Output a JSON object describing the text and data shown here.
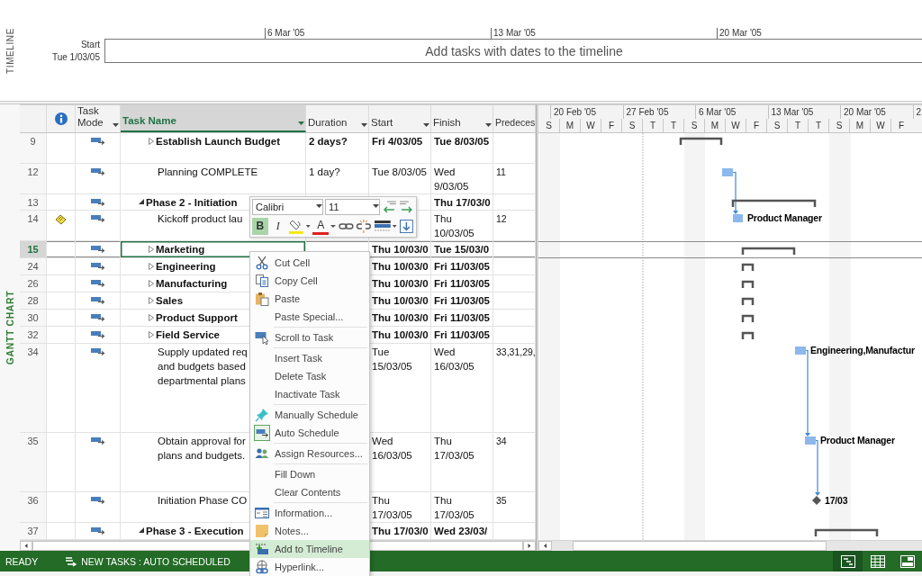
{
  "timeline": {
    "label": "TIMELINE",
    "ticks": [
      "6 Mar '05",
      "13 Mar '05",
      "20 Mar '05"
    ],
    "start_label": "Start",
    "start_date": "Tue 1/03/05",
    "placeholder": "Add tasks with dates to the timeline"
  },
  "view_label": "GANTT CHART",
  "table": {
    "columns": [
      {
        "kind": "row-number",
        "selected": false
      },
      {
        "kind": "indicators",
        "selected": false
      },
      {
        "kind": "heading",
        "label": "Task Mode",
        "filter": true,
        "selected": false
      },
      {
        "kind": "heading",
        "label": "Task Name",
        "filter": true,
        "selected": true
      },
      {
        "kind": "heading",
        "label": "Duration",
        "filter": true,
        "selected": false
      },
      {
        "kind": "heading",
        "label": "Start",
        "filter": true,
        "selected": false
      },
      {
        "kind": "heading",
        "label": "Finish",
        "filter": true,
        "selected": false
      },
      {
        "kind": "heading",
        "label": "Predeces",
        "filter": false,
        "selected": false
      }
    ],
    "leading_rows": [
      {
        "id": "9",
        "kind": "summary",
        "expanded": false,
        "note": false,
        "selected": false,
        "name": "Establish Launch Budget",
        "duration": "2 days?",
        "start": "Fri 4/03/05",
        "finish": "Tue 8/03/05",
        "bar": {
          "kind": "summary"
        }
      },
      {
        "id": "12",
        "kind": "task",
        "note": false,
        "selected": false,
        "name": "Planning COMPLETE",
        "duration": "1 day?",
        "start": "Tue 8/03/05",
        "finish": "Wed\n9/03/05",
        "predecessors": "11",
        "bar": {
          "kind": "task"
        }
      }
    ],
    "rows": [
      {
        "id": "13",
        "kind": "summary",
        "expanded": true,
        "note": false,
        "selected": false,
        "name": "Phase 2 - Initiation",
        "finish": "Thu 17/03/0",
        "bar": {
          "kind": "summary"
        },
        "children": [
          {
            "id": "14",
            "kind": "task",
            "note": true,
            "selected": false,
            "name": "Kickoff product lau",
            "finish": "Thu\n10/03/05",
            "predecessors": "12",
            "bar": {
              "kind": "task",
              "label": "Product Manager"
            }
          },
          {
            "id": "15",
            "kind": "summary",
            "expanded": false,
            "note": false,
            "selected": true,
            "name": "Marketing",
            "start": "Thu 10/03/0",
            "finish": "Tue 15/03/0",
            "bar": {
              "kind": "summary"
            }
          },
          {
            "id": "24",
            "kind": "summary",
            "expanded": false,
            "note": false,
            "selected": false,
            "name": "Engineering",
            "start": "Thu 10/03/0",
            "finish": "Fri 11/03/05",
            "bar": {
              "kind": "summary"
            }
          },
          {
            "id": "26",
            "kind": "summary",
            "expanded": false,
            "note": false,
            "selected": false,
            "name": "Manufacturing",
            "start": "Thu 10/03/0",
            "finish": "Fri 11/03/05",
            "bar": {
              "kind": "summary"
            }
          },
          {
            "id": "28",
            "kind": "summary",
            "expanded": false,
            "note": false,
            "selected": false,
            "name": "Sales",
            "start": "Thu 10/03/0",
            "finish": "Fri 11/03/05",
            "bar": {
              "kind": "summary"
            }
          },
          {
            "id": "30",
            "kind": "summary",
            "expanded": false,
            "note": false,
            "selected": false,
            "name": "Product Support",
            "start": "Thu 10/03/0",
            "finish": "Fri 11/03/05",
            "bar": {
              "kind": "summary"
            }
          },
          {
            "id": "32",
            "kind": "summary",
            "expanded": false,
            "note": false,
            "selected": false,
            "name": "Field Service",
            "start": "Thu 10/03/0",
            "finish": "Fri 11/03/05",
            "bar": {
              "kind": "summary"
            }
          },
          {
            "id": "34",
            "kind": "task",
            "note": false,
            "selected": false,
            "name": "Supply updated req\nand budgets based\ndepartmental plans",
            "start": "Tue\n15/03/05",
            "finish": "Wed\n16/03/05",
            "predecessors": "33,31,29,",
            "bar": {
              "kind": "task",
              "label": "Engineering,Manufactur"
            }
          },
          {
            "id": "35",
            "kind": "task",
            "note": false,
            "selected": false,
            "name": "Obtain approval for\nplans and budgets.",
            "start": "Wed\n16/03/05",
            "finish": "Thu\n17/03/05",
            "predecessors": "34",
            "bar": {
              "kind": "task",
              "label": "Product Manager"
            }
          },
          {
            "id": "36",
            "kind": "task",
            "note": false,
            "selected": false,
            "name": "Initiation Phase CO",
            "start": "Thu\n17/03/05",
            "finish": "Thu\n17/03/05",
            "predecessors": "35",
            "bar": {
              "kind": "milestone",
              "label": "17/03"
            }
          }
        ]
      },
      {
        "id": "37",
        "kind": "summary",
        "expanded": true,
        "note": false,
        "selected": false,
        "name": "Phase 3 - Execution",
        "start": "Thu 17/03/0",
        "finish": "Wed 23/03/",
        "bar": {
          "kind": "summary"
        }
      }
    ]
  },
  "gantt": {
    "weeks": [
      "20 Feb '05",
      "27 Feb '05",
      "6 Mar '05",
      "13 Mar '05",
      "20 Mar '05",
      "2"
    ],
    "days": [
      "S",
      "M",
      "W",
      "F",
      "S",
      "T",
      "T",
      "S",
      "M",
      "W",
      "F",
      "S",
      "T",
      "T",
      "S",
      "M",
      "W",
      "F"
    ]
  },
  "mini_toolbar": {
    "font": "Calibri",
    "size": "11",
    "buttons": [
      {
        "kind": "bold",
        "label": "B",
        "selected": true
      },
      {
        "kind": "italic",
        "label": "I",
        "selected": false
      },
      {
        "kind": "font-color",
        "label": "A",
        "selected": false
      }
    ]
  },
  "context_menu": {
    "items": [
      {
        "kind": "command",
        "label": "Cut Cell",
        "selected": false
      },
      {
        "kind": "command",
        "label": "Copy Cell",
        "selected": false
      },
      {
        "kind": "command",
        "label": "Paste",
        "selected": false
      },
      {
        "kind": "command",
        "label": "Paste Special...",
        "selected": false
      },
      {
        "kind": "separator"
      },
      {
        "kind": "command",
        "label": "Scroll to Task",
        "selected": false
      },
      {
        "kind": "separator"
      },
      {
        "kind": "command",
        "label": "Insert Task",
        "selected": false
      },
      {
        "kind": "command",
        "label": "Delete Task",
        "selected": false
      },
      {
        "kind": "command",
        "label": "Inactivate Task",
        "selected": false
      },
      {
        "kind": "separator"
      },
      {
        "kind": "command",
        "label": "Manually Schedule",
        "selected": false
      },
      {
        "kind": "command",
        "label": "Auto Schedule",
        "selected": false
      },
      {
        "kind": "separator"
      },
      {
        "kind": "command",
        "label": "Assign Resources...",
        "selected": false
      },
      {
        "kind": "separator"
      },
      {
        "kind": "command",
        "label": "Fill Down",
        "selected": false
      },
      {
        "kind": "command",
        "label": "Clear Contents",
        "selected": false
      },
      {
        "kind": "separator"
      },
      {
        "kind": "command",
        "label": "Information...",
        "selected": false
      },
      {
        "kind": "command",
        "label": "Notes...",
        "selected": false
      },
      {
        "kind": "command",
        "label": "Add to Timeline",
        "selected": true
      },
      {
        "kind": "command",
        "label": "Hyperlink...",
        "selected": false
      }
    ]
  },
  "status_bar": {
    "mode": "READY",
    "new_tasks": "NEW TASKS : AUTO SCHEDULED",
    "views": [
      {
        "selected": true
      },
      {
        "selected": false
      },
      {
        "selected": false
      }
    ]
  }
}
